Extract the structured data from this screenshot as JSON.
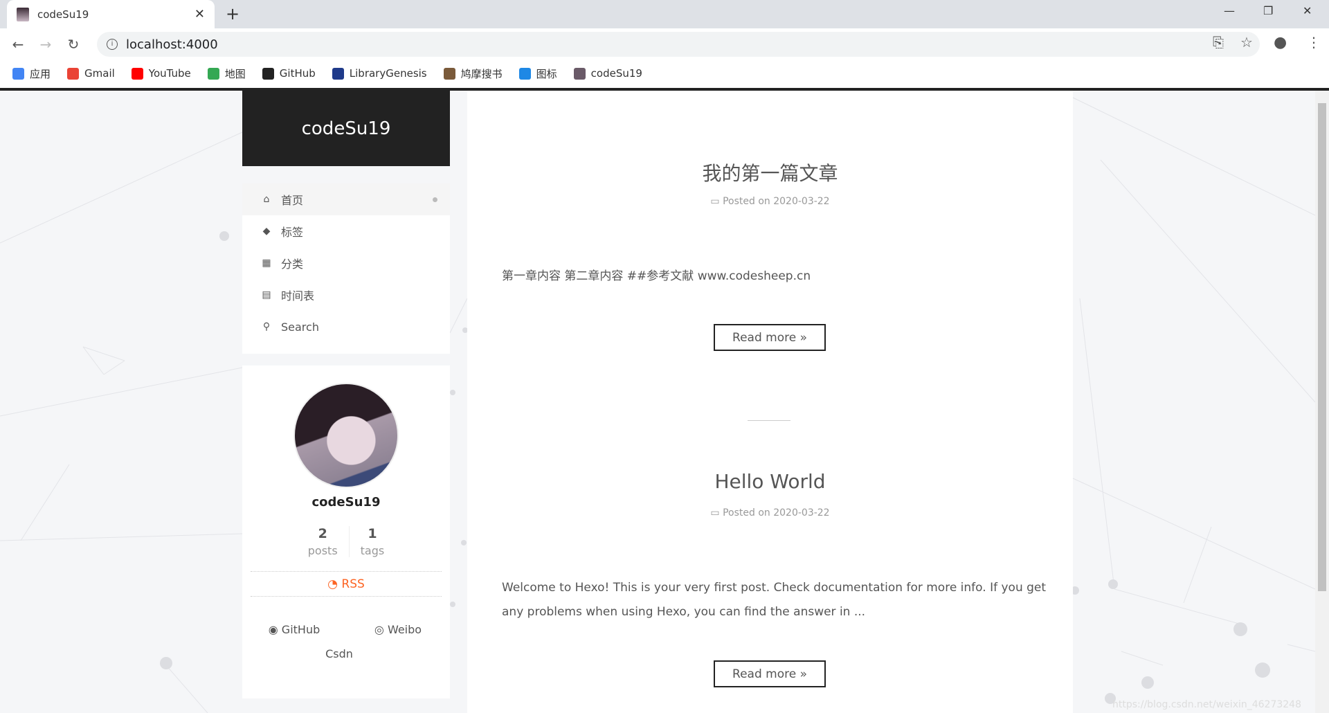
{
  "browser": {
    "tab_title": "codeSu19",
    "url": "localhost:4000",
    "bookmarks": [
      {
        "label": "应用",
        "icon": "apps-grid-icon",
        "color": "#4285f4"
      },
      {
        "label": "Gmail",
        "icon": "gmail-icon",
        "color": "#ea4335"
      },
      {
        "label": "YouTube",
        "icon": "youtube-icon",
        "color": "#ff0000"
      },
      {
        "label": "地图",
        "icon": "maps-icon",
        "color": "#34a853"
      },
      {
        "label": "GitHub",
        "icon": "github-icon",
        "color": "#222222"
      },
      {
        "label": "LibraryGenesis",
        "icon": "library-icon",
        "color": "#1f3a8a"
      },
      {
        "label": "鸠摩搜书",
        "icon": "j-icon",
        "color": "#7a5a3a"
      },
      {
        "label": "图标",
        "icon": "flag-icon",
        "color": "#1e88e5"
      },
      {
        "label": "codeSu19",
        "icon": "avatar-icon",
        "color": "#6a5a68"
      }
    ]
  },
  "site": {
    "brand": "codeSu19",
    "menu": [
      {
        "label": "首页",
        "icon": "home-icon",
        "glyph": "⌂",
        "active": true
      },
      {
        "label": "标签",
        "icon": "tags-icon",
        "glyph": "◆"
      },
      {
        "label": "分类",
        "icon": "th-icon",
        "glyph": "▦"
      },
      {
        "label": "时间表",
        "icon": "calendar-icon",
        "glyph": "▤"
      },
      {
        "label": "Search",
        "icon": "search-icon",
        "glyph": "⚲"
      }
    ],
    "profile": {
      "name": "codeSu19",
      "posts_count": "2",
      "posts_label": "posts",
      "tags_count": "1",
      "tags_label": "tags",
      "rss": "RSS",
      "links": [
        {
          "label": "GitHub",
          "icon": "github-icon"
        },
        {
          "label": "Weibo",
          "icon": "weibo-icon"
        },
        {
          "label": "Csdn",
          "icon": ""
        }
      ]
    }
  },
  "posts": [
    {
      "title": "我的第一篇文章",
      "meta": "Posted on 2020-03-22",
      "excerpt": "第一章内容 第二章内容 ##参考文献 www.codesheep.cn",
      "read_more": "Read more »"
    },
    {
      "title": "Hello World",
      "meta": "Posted on 2020-03-22",
      "excerpt": "Welcome to Hexo! This is your very first post. Check documentation for more info. If you get any problems when using Hexo, you can find the answer in ...",
      "read_more": "Read more »"
    }
  ],
  "watermark": "https://blog.csdn.net/weixin_46273248",
  "colors": {
    "accent_rss": "#fc6423",
    "brand_bg": "#222222"
  }
}
